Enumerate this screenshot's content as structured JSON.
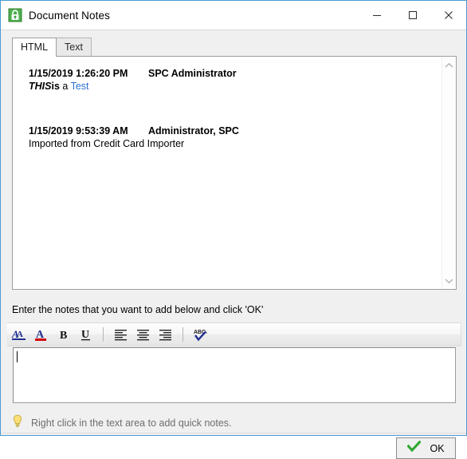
{
  "window": {
    "title": "Document Notes",
    "icon": "green-lock-document-icon",
    "border_color": "#4a9ad4",
    "controls": [
      {
        "name": "minimize",
        "glyph": "minimize-icon"
      },
      {
        "name": "maximize",
        "glyph": "maximize-icon"
      },
      {
        "name": "close",
        "glyph": "close-icon"
      }
    ]
  },
  "tabs": [
    {
      "label": "HTML",
      "active": true
    },
    {
      "label": "Text",
      "active": false
    }
  ],
  "notes": [
    {
      "date": "1/15/2019 1:26:20 PM",
      "author": "SPC Administrator",
      "body_runs": [
        {
          "text": "THIS",
          "style": "bold-italic"
        },
        {
          "text": "is",
          "style": "bold"
        },
        {
          "text": " a ",
          "style": "normal"
        },
        {
          "text": "Test",
          "style": "link"
        }
      ]
    },
    {
      "date": "1/15/2019 9:53:39 AM",
      "author": "Administrator, SPC",
      "body_runs": [
        {
          "text": "Imported from Credit Card Importer",
          "style": "normal"
        }
      ]
    }
  ],
  "scrollbar": {
    "up_arrow": "chevron-up-icon",
    "down_arrow": "chevron-down-icon"
  },
  "instruction": "Enter the notes that you want to add below and click 'OK'",
  "toolbar": [
    {
      "name": "font-color-button",
      "icon": "font-color-icon",
      "title": "Font Color"
    },
    {
      "name": "highlight-color-button",
      "icon": "highlight-color-icon",
      "title": "Highlight Color"
    },
    {
      "name": "bold-button",
      "icon": "bold-icon",
      "title": "Bold",
      "label": "B"
    },
    {
      "name": "underline-button",
      "icon": "underline-icon",
      "title": "Underline",
      "label": "U"
    },
    {
      "name": "separator-1",
      "icon": "separator"
    },
    {
      "name": "align-left-button",
      "icon": "align-left-icon",
      "title": "Align Left"
    },
    {
      "name": "align-center-button",
      "icon": "align-center-icon",
      "title": "Align Center"
    },
    {
      "name": "align-right-button",
      "icon": "align-right-icon",
      "title": "Align Right"
    },
    {
      "name": "separator-2",
      "icon": "separator"
    },
    {
      "name": "spell-check-button",
      "icon": "spell-check-icon",
      "title": "Spell Check",
      "label": "ABC"
    }
  ],
  "editor": {
    "value": "",
    "placeholder": ""
  },
  "hint": {
    "icon": "lightbulb-icon",
    "text": "Right click in the text area to add quick notes."
  },
  "footer": {
    "ok_label": "OK",
    "ok_icon": "green-check-icon"
  },
  "colors": {
    "accent_border": "#4a9ad4",
    "link": "#2a6fd4",
    "hint_text": "#6d6d6d",
    "icon_green": "#3aa93a",
    "icon_blue": "#1f2f8f",
    "icon_red": "#d40000",
    "lightbulb": "#f5d33f"
  }
}
